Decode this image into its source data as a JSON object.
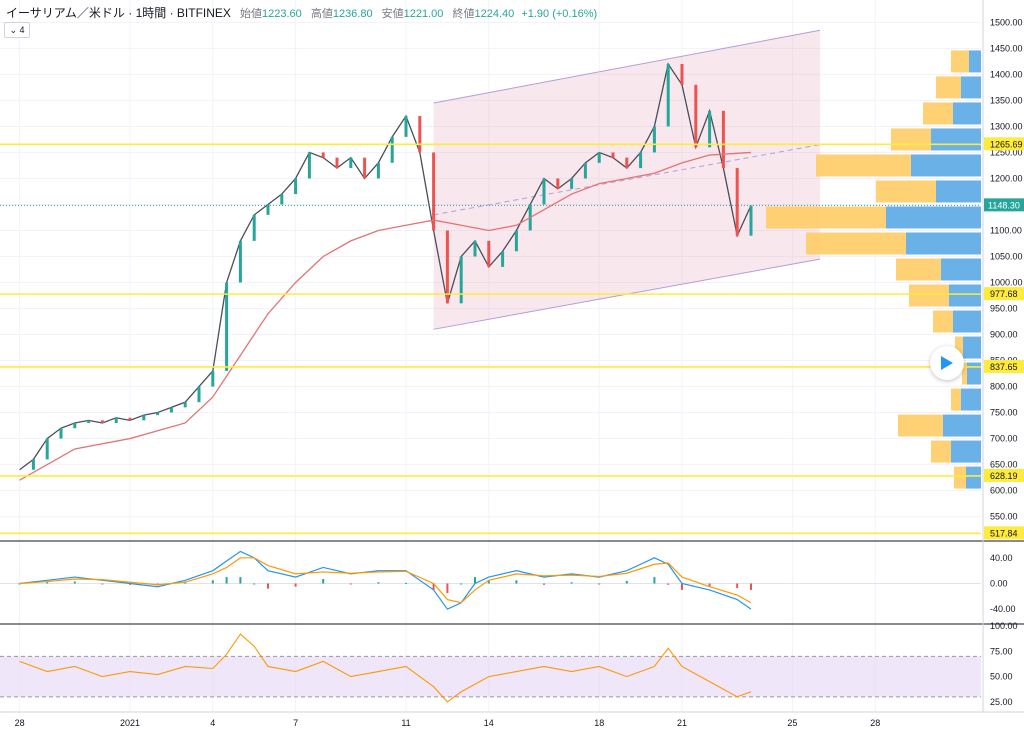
{
  "header": {
    "symbol": "イーサリアム／米ドル · 1時間 · BITFINEX",
    "open_label": "始値",
    "open": "1223.60",
    "high_label": "高値",
    "high": "1236.80",
    "low_label": "安値",
    "low": "1221.00",
    "close_label": "終値",
    "close": "1224.40",
    "change": "+1.90 (+0.16%)"
  },
  "indicator_toggle": "4",
  "colors": {
    "up": "#26a69a",
    "down": "#ef5350",
    "hline": "#ffeb3b",
    "ma": "#e57373",
    "channel": "#b39ddb",
    "vp_up": "#ffcc66",
    "vp_down": "#5aa9e6",
    "macd": "#2196f3",
    "signal": "#ff9800",
    "rsi": "#ff9800",
    "rsi_band": "#e6d5f7"
  },
  "chart_data": {
    "type": "line",
    "title": "イーサリアム／米ドル · 1時間 · BITFINEX",
    "x_ticks": [
      "28",
      "2021",
      "4",
      "7",
      "11",
      "14",
      "18",
      "21",
      "25",
      "28"
    ],
    "y_ticks": [
      "1500.00",
      "1450.00",
      "1400.00",
      "1350.00",
      "1300.00",
      "1250.00",
      "1200.00",
      "1150.00",
      "1100.00",
      "1050.00",
      "1000.00",
      "950.00",
      "900.00",
      "850.00",
      "800.00",
      "750.00",
      "700.00",
      "650.00",
      "600.00",
      "550.00"
    ],
    "price_range": [
      505,
      1520
    ],
    "horizontal_levels": [
      {
        "label": "1265.69",
        "value": 1265.69
      },
      {
        "label": "977.68",
        "value": 977.68
      },
      {
        "label": "837.65",
        "value": 837.65
      },
      {
        "label": "628.19",
        "value": 628.19
      },
      {
        "label": "517.84",
        "value": 517.84
      }
    ],
    "last_price": {
      "label": "1148.30",
      "value": 1148.3
    },
    "price_path": {
      "x_day": [
        -4,
        -3.5,
        -3,
        -2.5,
        -2,
        -1.5,
        -1,
        -0.5,
        0,
        0.5,
        1,
        1.5,
        2,
        2.5,
        3,
        3.5,
        4,
        4.5,
        5,
        5.5,
        6,
        6.5,
        7,
        7.5,
        8,
        8.5,
        9,
        9.5,
        10,
        10.5,
        11,
        11.5,
        12,
        12.5,
        13,
        13.5,
        14,
        14.5,
        15,
        15.5,
        16,
        16.5,
        17,
        17.5,
        18,
        18.5,
        19,
        19.5,
        20,
        20.5,
        21,
        21.5,
        22,
        22.5
      ],
      "close": [
        640,
        660,
        700,
        720,
        730,
        735,
        730,
        740,
        735,
        745,
        750,
        760,
        770,
        800,
        830,
        1000,
        1080,
        1130,
        1150,
        1170,
        1200,
        1250,
        1240,
        1220,
        1240,
        1200,
        1230,
        1280,
        1320,
        1250,
        1100,
        960,
        1050,
        1080,
        1030,
        1060,
        1100,
        1150,
        1200,
        1180,
        1200,
        1230,
        1250,
        1240,
        1220,
        1250,
        1300,
        1420,
        1380,
        1260,
        1330,
        1220,
        1090,
        1148
      ]
    },
    "ma_line": {
      "x_day": [
        -4,
        -2,
        0,
        2,
        3,
        4,
        5,
        6,
        7,
        8,
        9,
        10,
        11,
        12,
        13,
        14,
        15,
        16,
        17,
        18,
        19,
        20,
        21,
        22.5
      ],
      "value": [
        620,
        680,
        700,
        730,
        780,
        860,
        940,
        1000,
        1050,
        1080,
        1100,
        1110,
        1120,
        1110,
        1100,
        1110,
        1140,
        1170,
        1190,
        1200,
        1210,
        1230,
        1245,
        1250
      ]
    },
    "channel": {
      "upper": [
        [
          11,
          1345
        ],
        [
          25,
          1485
        ]
      ],
      "lower": [
        [
          11,
          910
        ],
        [
          25,
          1045
        ]
      ],
      "mid": [
        [
          11,
          1130
        ],
        [
          25,
          1265
        ]
      ]
    },
    "volume_profile": [
      {
        "price": 1425,
        "up": 18,
        "down": 12
      },
      {
        "price": 1375,
        "up": 25,
        "down": 20
      },
      {
        "price": 1325,
        "up": 30,
        "down": 28
      },
      {
        "price": 1275,
        "up": 40,
        "down": 50
      },
      {
        "price": 1225,
        "up": 95,
        "down": 70
      },
      {
        "price": 1175,
        "up": 60,
        "down": 45
      },
      {
        "price": 1125,
        "up": 120,
        "down": 95
      },
      {
        "price": 1075,
        "up": 100,
        "down": 75
      },
      {
        "price": 1025,
        "up": 45,
        "down": 40
      },
      {
        "price": 975,
        "up": 40,
        "down": 32
      },
      {
        "price": 925,
        "up": 20,
        "down": 28
      },
      {
        "price": 875,
        "up": 8,
        "down": 18
      },
      {
        "price": 825,
        "up": 5,
        "down": 14
      },
      {
        "price": 775,
        "up": 10,
        "down": 20
      },
      {
        "price": 725,
        "up": 45,
        "down": 38
      },
      {
        "price": 675,
        "up": 20,
        "down": 30
      },
      {
        "price": 625,
        "up": 12,
        "down": 15
      }
    ],
    "macd": {
      "y_ticks": [
        "40.00",
        "0.00",
        "-40.00"
      ],
      "range": [
        -60,
        60
      ],
      "x_day": [
        -4,
        -3,
        -2,
        -1,
        0,
        1,
        2,
        3,
        3.5,
        4,
        4.5,
        5,
        6,
        7,
        8,
        9,
        10,
        11,
        11.5,
        12,
        12.5,
        13,
        14,
        15,
        16,
        17,
        18,
        19,
        19.5,
        20,
        21,
        22,
        22.5
      ],
      "macd": [
        0,
        5,
        10,
        5,
        0,
        -5,
        5,
        20,
        35,
        50,
        40,
        20,
        10,
        25,
        15,
        20,
        20,
        -10,
        -40,
        -30,
        0,
        10,
        20,
        10,
        15,
        10,
        20,
        40,
        30,
        0,
        -10,
        -25,
        -40
      ],
      "signal": [
        0,
        3,
        7,
        6,
        2,
        -2,
        2,
        15,
        25,
        40,
        40,
        28,
        15,
        18,
        16,
        18,
        19,
        0,
        -25,
        -30,
        -10,
        5,
        15,
        12,
        13,
        11,
        16,
        30,
        32,
        10,
        -5,
        -18,
        -30
      ]
    },
    "rsi": {
      "y_ticks": [
        "100.00",
        "75.00",
        "50.00",
        "25.00"
      ],
      "range": [
        15,
        100
      ],
      "band": [
        30,
        70
      ],
      "x_day": [
        -4,
        -3,
        -2,
        -1,
        0,
        1,
        2,
        3,
        3.5,
        4,
        4.5,
        5,
        6,
        7,
        8,
        9,
        10,
        11,
        11.5,
        12,
        13,
        14,
        15,
        16,
        17,
        18,
        19,
        19.5,
        20,
        21,
        22,
        22.5
      ],
      "value": [
        65,
        55,
        60,
        50,
        55,
        52,
        60,
        58,
        72,
        92,
        80,
        60,
        55,
        65,
        50,
        55,
        60,
        40,
        25,
        35,
        50,
        55,
        60,
        55,
        60,
        50,
        60,
        78,
        60,
        45,
        30,
        35
      ]
    }
  }
}
